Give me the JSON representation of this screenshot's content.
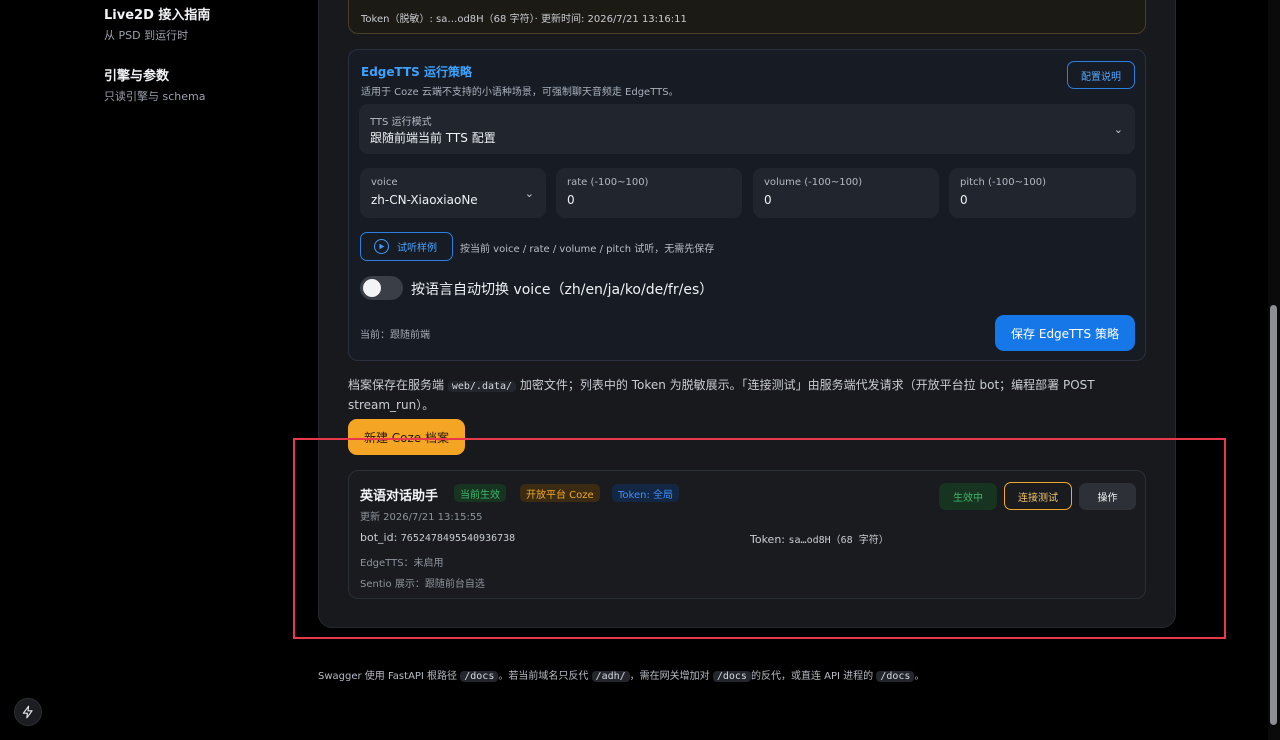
{
  "sidebar": {
    "items": [
      {
        "title": "Live2D 接入指南",
        "subtitle": "从 PSD 到运行时"
      },
      {
        "title": "引擎与参数",
        "subtitle": "只读引擎与 schema"
      }
    ]
  },
  "token_bar": {
    "text": "Token（脱敏）: sa…od8H（68 字符）· 更新时间: 2026/7/21 13:16:11"
  },
  "edge_tts": {
    "title": "EdgeTTS 运行策略",
    "description": "适用于 Coze 云端不支持的小语种场景，可强制聊天音频走 EdgeTTS。",
    "config_button": "配置说明",
    "mode": {
      "label": "TTS 运行模式",
      "value": "跟随前端当前 TTS 配置"
    },
    "voice": {
      "label": "voice",
      "value": "zh-CN-XiaoxiaoNe"
    },
    "rate": {
      "label": "rate (-100~100)",
      "value": "0"
    },
    "volume": {
      "label": "volume (-100~100)",
      "value": "0"
    },
    "pitch": {
      "label": "pitch (-100~100)",
      "value": "0"
    },
    "preview_button": "试听样例",
    "preview_hint": "按当前 voice / rate / volume / pitch 试听，无需先保存",
    "auto_switch": {
      "label": "按语言自动切换 voice（zh/en/ja/ko/de/fr/es）",
      "enabled": false
    },
    "current": "当前：跟随前端",
    "save_button": "保存 EdgeTTS 策略"
  },
  "archive_note": {
    "part1": "档案保存在服务端",
    "code": "web/.data/",
    "part2": "加密文件；列表中的 Token 为脱敏展示。「连接测试」由服务端代发请求（开放平台拉 bot；编程部署 POST stream_run）。"
  },
  "new_profile_button": "新建 Coze 档案",
  "profile": {
    "name": "英语对话助手",
    "tags": [
      {
        "label": "当前生效",
        "color": "#3fb76b"
      },
      {
        "label": "开放平台 Coze",
        "color": "#f0a92e"
      },
      {
        "label": "Token: 全局",
        "color": "#3f8fff"
      }
    ],
    "updated": "更新 2026/7/21 13:15:55",
    "bot_id_label": "bot_id:",
    "bot_id": "7652478495540936738",
    "token_label": "Token:",
    "token": "sa…od8H（68 字符）",
    "edge_tts": "EdgeTTS：未启用",
    "sentio": "Sentio 展示：跟随前台自选",
    "active_button": "生效中",
    "test_button": "连接测试",
    "ops_button": "操作"
  },
  "footer": {
    "p1": "Swagger 使用 FastAPI 根路径",
    "c1": "/docs",
    "p2": "。若当前域名只反代",
    "c2": "/adh/",
    "p3": "，需在网关增加对",
    "c3": "/docs",
    "p4": "的反代，或直连 API 进程的",
    "c4": "/docs",
    "p5": "。"
  }
}
